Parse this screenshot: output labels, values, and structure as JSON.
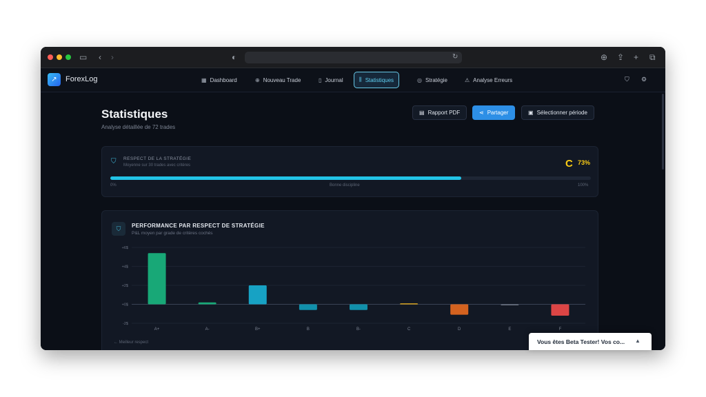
{
  "browser": {
    "url": "",
    "traffic_lights": [
      "#ff5f57",
      "#febc2e",
      "#28c840"
    ]
  },
  "app": {
    "brand": "ForexLog",
    "nav": [
      {
        "label": "Dashboard",
        "icon": "grid-icon"
      },
      {
        "label": "Nouveau Trade",
        "icon": "plus-circle-icon"
      },
      {
        "label": "Journal",
        "icon": "book-icon"
      },
      {
        "label": "Statistiques",
        "icon": "bar-chart-icon",
        "active": true
      },
      {
        "label": "Stratégie",
        "icon": "target-icon"
      },
      {
        "label": "Analyse Erreurs",
        "icon": "warning-icon"
      }
    ]
  },
  "page": {
    "title": "Statistiques",
    "subtitle": "Analyse détaillée de 72 trades",
    "actions": {
      "pdf": "Rapport PDF",
      "share": "Partager",
      "period": "Sélectionner période"
    }
  },
  "respect": {
    "title": "RESPECT DE LA STRATÉGIE",
    "subtitle": "Moyenne sur 30 trades avec critères",
    "grade": "C",
    "percent_label": "73%",
    "value": 0.73,
    "scale_min": "0%",
    "scale_mid": "Bonne discipline",
    "scale_max": "100%"
  },
  "performance": {
    "title": "PERFORMANCE PAR RESPECT DE STRATÉGIE",
    "subtitle": "P&L moyen par grade de critères cochés",
    "footnote": "← Meilleur respect"
  },
  "chart_data": {
    "type": "bar",
    "title": "PERFORMANCE PAR RESPECT DE STRATÉGIE",
    "subtitle": "P&L moyen par grade de critères cochés",
    "categories": [
      "A+",
      "A-",
      "B+",
      "B",
      "B-",
      "C",
      "D",
      "E",
      "F"
    ],
    "values": [
      5.4,
      0.2,
      2.0,
      -0.6,
      -0.6,
      0.1,
      -1.1,
      0.0,
      -1.2
    ],
    "colors": [
      "#18a877",
      "#18a877",
      "#17a2c4",
      "#1190ab",
      "#1190ab",
      "#d6a21e",
      "#d4621f",
      "#6b7280",
      "#dc4545"
    ],
    "yticks": [
      "+6$",
      "+4$",
      "+2$",
      "+0$",
      "-2$"
    ],
    "ylim": [
      -2,
      6
    ],
    "grid": true
  },
  "toast": {
    "text": "Vous êtes Beta Tester! Vos co..."
  },
  "colors": {
    "background": "#0b0f17",
    "card": "#121824",
    "accent": "#22c3e6",
    "grade": "#facc15",
    "primary_button": "#2d8fe6"
  }
}
